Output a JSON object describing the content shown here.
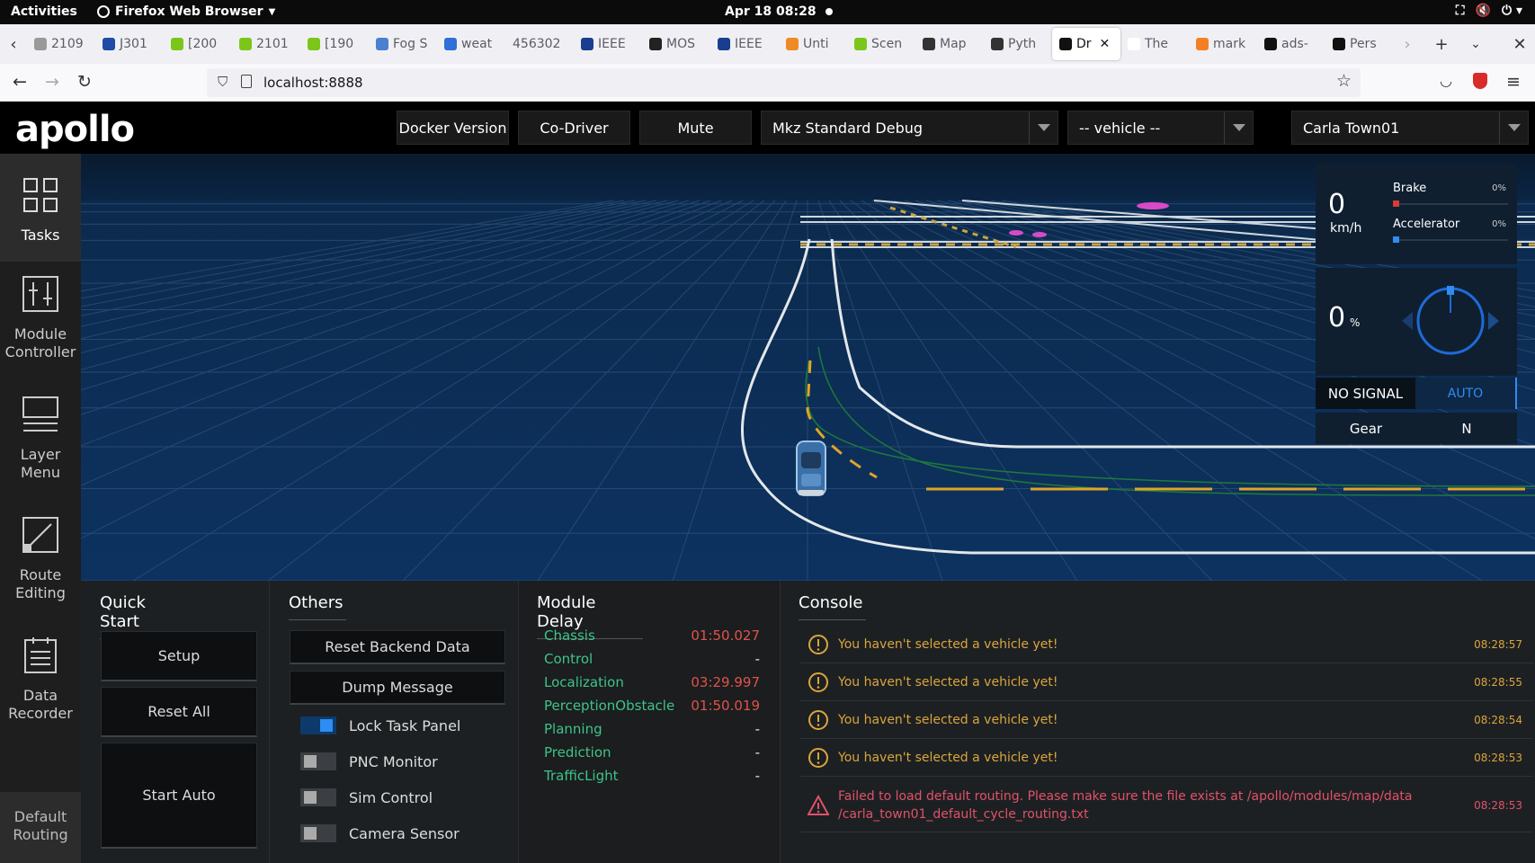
{
  "system_bar": {
    "activities": "Activities",
    "app_name": "Firefox Web Browser",
    "datetime": "Apr 18  08:28"
  },
  "browser": {
    "tabs": [
      {
        "label": "2109",
        "icon": "doc-icon",
        "color": "#999999"
      },
      {
        "label": "J301",
        "icon": "sae-icon",
        "color": "#1f4aa8"
      },
      {
        "label": "[200",
        "icon": "smiley-icon",
        "color": "#7cc619"
      },
      {
        "label": "2101",
        "icon": "smiley-icon",
        "color": "#7cc619"
      },
      {
        "label": "[190",
        "icon": "smiley-icon",
        "color": "#7cc619"
      },
      {
        "label": "Fog S",
        "icon": "cvf-icon",
        "color": "#4a7fd1"
      },
      {
        "label": "weat",
        "icon": "diamond-icon",
        "color": "#2f6fd8"
      },
      {
        "label": "456302",
        "icon": "none",
        "color": "#f0f0f4"
      },
      {
        "label": "IEEE",
        "icon": "ieee-icon",
        "color": "#1b3d8f"
      },
      {
        "label": "MOS",
        "icon": "gear-icon",
        "color": "#222222"
      },
      {
        "label": "IEEE",
        "icon": "ieee-icon",
        "color": "#1b3d8f"
      },
      {
        "label": "Unti",
        "icon": "grid-icon",
        "color": "#f08a24"
      },
      {
        "label": "Scen",
        "icon": "smiley-icon",
        "color": "#7cc619"
      },
      {
        "label": "Map",
        "icon": "book-icon",
        "color": "#333333"
      },
      {
        "label": "Pyth",
        "icon": "book-icon",
        "color": "#333333"
      },
      {
        "label": "Dr",
        "icon": "driver-icon",
        "color": "#111111",
        "active": true
      },
      {
        "label": "The",
        "icon": "square-icon",
        "color": "#ffffff"
      },
      {
        "label": "mark",
        "icon": "stack-icon",
        "color": "#f48024"
      },
      {
        "label": "ads-",
        "icon": "github-icon",
        "color": "#111111"
      },
      {
        "label": "Pers",
        "icon": "github-icon",
        "color": "#111111"
      }
    ],
    "url": "localhost:8888"
  },
  "header": {
    "logo": "apollo",
    "docker_version": "Docker Version",
    "co_driver": "Co-Driver",
    "mute": "Mute",
    "mode_select": "Mkz Standard Debug",
    "vehicle_select": "-- vehicle --",
    "map_select": "Carla Town01"
  },
  "sidenav": {
    "items": [
      {
        "label1": "Tasks",
        "label2": "",
        "icon": "grid-icon",
        "active": true
      },
      {
        "label1": "Module",
        "label2": "Controller",
        "icon": "sliders-icon"
      },
      {
        "label1": "Layer",
        "label2": "Menu",
        "icon": "layers-icon"
      },
      {
        "label1": "Route",
        "label2": "Editing",
        "icon": "route-icon"
      },
      {
        "label1": "Data",
        "label2": "Recorder",
        "icon": "document-icon"
      },
      {
        "label1": "Default",
        "label2": "Routing",
        "icon": "none"
      }
    ]
  },
  "dashboard": {
    "speed": "0",
    "speed_unit": "km/h",
    "brake_label": "Brake",
    "brake_pct": "0%",
    "brake_level": 0,
    "accel_label": "Accelerator",
    "accel_pct": "0%",
    "accel_level": 0,
    "steering": "0",
    "steering_unit": "%",
    "signal": "NO SIGNAL",
    "drive_mode": "AUTO",
    "gear_label": "Gear",
    "gear_value": "N"
  },
  "quick_start": {
    "title": "Quick Start",
    "setup": "Setup",
    "reset_all": "Reset All",
    "start_auto": "Start Auto"
  },
  "others": {
    "title": "Others",
    "reset_backend": "Reset Backend Data",
    "dump_message": "Dump Message",
    "toggles": [
      {
        "label": "Lock Task Panel",
        "on": true
      },
      {
        "label": "PNC Monitor",
        "on": false
      },
      {
        "label": "Sim Control",
        "on": false
      },
      {
        "label": "Camera Sensor",
        "on": false
      }
    ]
  },
  "module_delay": {
    "title": "Module Delay",
    "rows": [
      {
        "name": "Chassis",
        "value": "01:50.027",
        "alert": true
      },
      {
        "name": "Control",
        "value": "-",
        "alert": false
      },
      {
        "name": "Localization",
        "value": "03:29.997",
        "alert": true
      },
      {
        "name": "PerceptionObstacle",
        "value": "01:50.019",
        "alert": true
      },
      {
        "name": "Planning",
        "value": "-",
        "alert": false
      },
      {
        "name": "Prediction",
        "value": "-",
        "alert": false
      },
      {
        "name": "TrafficLight",
        "value": "-",
        "alert": false
      }
    ]
  },
  "console": {
    "title": "Console",
    "messages": [
      {
        "text": "You haven't selected a vehicle yet!",
        "time": "08:28:57",
        "level": "warning"
      },
      {
        "text": "You haven't selected a vehicle yet!",
        "time": "08:28:55",
        "level": "warning"
      },
      {
        "text": "You haven't selected a vehicle yet!",
        "time": "08:28:54",
        "level": "warning"
      },
      {
        "text": "You haven't selected a vehicle yet!",
        "time": "08:28:53",
        "level": "warning"
      },
      {
        "text": "Failed to load default routing. Please make sure the file exists at /apollo/modules/map/data",
        "text2": "/carla_town01_default_cycle_routing.txt",
        "time": "08:28:53",
        "level": "error"
      }
    ]
  },
  "colors": {
    "warning": "#d9a53d",
    "error": "#e0526b",
    "module_name": "#3ec48a",
    "module_alert": "#e0524a",
    "scene_bg": "#0a2444",
    "accent_blue": "#2f8cf0"
  }
}
